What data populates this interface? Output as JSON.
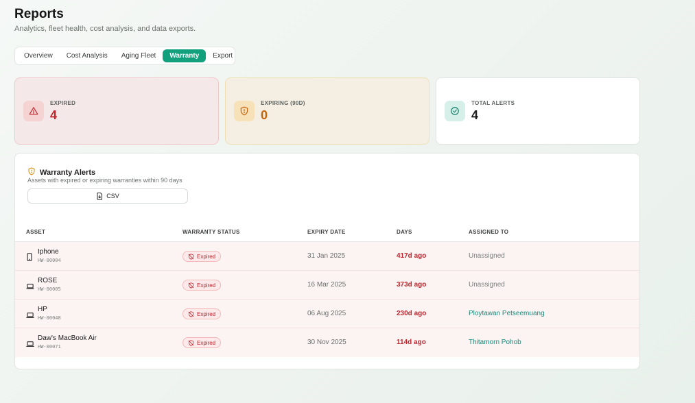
{
  "page": {
    "title": "Reports",
    "subtitle": "Analytics, fleet health, cost analysis, and data exports."
  },
  "tabs": [
    {
      "label": "Overview",
      "active": false
    },
    {
      "label": "Cost Analysis",
      "active": false
    },
    {
      "label": "Aging Fleet",
      "active": false
    },
    {
      "label": "Warranty",
      "active": true
    },
    {
      "label": "Export",
      "active": false
    }
  ],
  "stats": {
    "expired": {
      "label": "EXPIRED",
      "value": "4",
      "icon": "alert-triangle-icon"
    },
    "expiring": {
      "label": "EXPIRING (90D)",
      "value": "0",
      "icon": "shield-alert-icon"
    },
    "total": {
      "label": "TOTAL ALERTS",
      "value": "4",
      "icon": "check-circle-icon"
    }
  },
  "warranty_alerts": {
    "title": "Warranty Alerts",
    "subtitle": "Assets with expired or expiring warranties within 90 days",
    "csv_label": "CSV",
    "columns": [
      "ASSET",
      "WARRANTY STATUS",
      "EXPIRY DATE",
      "DAYS",
      "ASSIGNED TO"
    ],
    "rows": [
      {
        "asset": "Iphone",
        "id": "HW-00004",
        "type": "phone",
        "status": "Expired",
        "expiry": "31 Jan 2025",
        "days": "417d ago",
        "assigned": "Unassigned",
        "assigned_link": false
      },
      {
        "asset": "ROSE",
        "id": "HW-00005",
        "type": "laptop",
        "status": "Expired",
        "expiry": "16 Mar 2025",
        "days": "373d ago",
        "assigned": "Unassigned",
        "assigned_link": false
      },
      {
        "asset": "HP",
        "id": "HW-00048",
        "type": "laptop",
        "status": "Expired",
        "expiry": "06 Aug 2025",
        "days": "230d ago",
        "assigned": "Ploytawan Petseemuang",
        "assigned_link": true
      },
      {
        "asset": "Daw's MacBook Air",
        "id": "HW-00071",
        "type": "laptop",
        "status": "Expired",
        "expiry": "30 Nov 2025",
        "days": "114d ago",
        "assigned": "Thitamorn Pohob",
        "assigned_link": true
      }
    ]
  },
  "colors": {
    "accent": "#12a07d",
    "danger": "#c0262d",
    "warning": "#c5620a",
    "link": "#1a8a78"
  }
}
